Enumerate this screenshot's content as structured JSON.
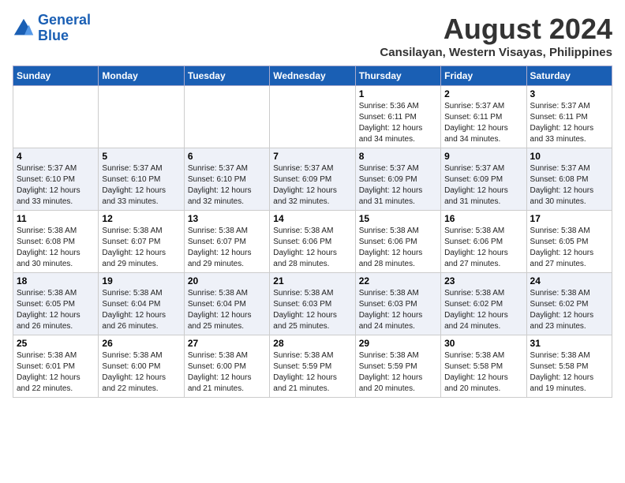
{
  "header": {
    "logo_line1": "General",
    "logo_line2": "Blue",
    "month_year": "August 2024",
    "location": "Cansilayan, Western Visayas, Philippines"
  },
  "days_of_week": [
    "Sunday",
    "Monday",
    "Tuesday",
    "Wednesday",
    "Thursday",
    "Friday",
    "Saturday"
  ],
  "weeks": [
    [
      {
        "day": "",
        "info": ""
      },
      {
        "day": "",
        "info": ""
      },
      {
        "day": "",
        "info": ""
      },
      {
        "day": "",
        "info": ""
      },
      {
        "day": "1",
        "info": "Sunrise: 5:36 AM\nSunset: 6:11 PM\nDaylight: 12 hours\nand 34 minutes."
      },
      {
        "day": "2",
        "info": "Sunrise: 5:37 AM\nSunset: 6:11 PM\nDaylight: 12 hours\nand 34 minutes."
      },
      {
        "day": "3",
        "info": "Sunrise: 5:37 AM\nSunset: 6:11 PM\nDaylight: 12 hours\nand 33 minutes."
      }
    ],
    [
      {
        "day": "4",
        "info": "Sunrise: 5:37 AM\nSunset: 6:10 PM\nDaylight: 12 hours\nand 33 minutes."
      },
      {
        "day": "5",
        "info": "Sunrise: 5:37 AM\nSunset: 6:10 PM\nDaylight: 12 hours\nand 33 minutes."
      },
      {
        "day": "6",
        "info": "Sunrise: 5:37 AM\nSunset: 6:10 PM\nDaylight: 12 hours\nand 32 minutes."
      },
      {
        "day": "7",
        "info": "Sunrise: 5:37 AM\nSunset: 6:09 PM\nDaylight: 12 hours\nand 32 minutes."
      },
      {
        "day": "8",
        "info": "Sunrise: 5:37 AM\nSunset: 6:09 PM\nDaylight: 12 hours\nand 31 minutes."
      },
      {
        "day": "9",
        "info": "Sunrise: 5:37 AM\nSunset: 6:09 PM\nDaylight: 12 hours\nand 31 minutes."
      },
      {
        "day": "10",
        "info": "Sunrise: 5:37 AM\nSunset: 6:08 PM\nDaylight: 12 hours\nand 30 minutes."
      }
    ],
    [
      {
        "day": "11",
        "info": "Sunrise: 5:38 AM\nSunset: 6:08 PM\nDaylight: 12 hours\nand 30 minutes."
      },
      {
        "day": "12",
        "info": "Sunrise: 5:38 AM\nSunset: 6:07 PM\nDaylight: 12 hours\nand 29 minutes."
      },
      {
        "day": "13",
        "info": "Sunrise: 5:38 AM\nSunset: 6:07 PM\nDaylight: 12 hours\nand 29 minutes."
      },
      {
        "day": "14",
        "info": "Sunrise: 5:38 AM\nSunset: 6:06 PM\nDaylight: 12 hours\nand 28 minutes."
      },
      {
        "day": "15",
        "info": "Sunrise: 5:38 AM\nSunset: 6:06 PM\nDaylight: 12 hours\nand 28 minutes."
      },
      {
        "day": "16",
        "info": "Sunrise: 5:38 AM\nSunset: 6:06 PM\nDaylight: 12 hours\nand 27 minutes."
      },
      {
        "day": "17",
        "info": "Sunrise: 5:38 AM\nSunset: 6:05 PM\nDaylight: 12 hours\nand 27 minutes."
      }
    ],
    [
      {
        "day": "18",
        "info": "Sunrise: 5:38 AM\nSunset: 6:05 PM\nDaylight: 12 hours\nand 26 minutes."
      },
      {
        "day": "19",
        "info": "Sunrise: 5:38 AM\nSunset: 6:04 PM\nDaylight: 12 hours\nand 26 minutes."
      },
      {
        "day": "20",
        "info": "Sunrise: 5:38 AM\nSunset: 6:04 PM\nDaylight: 12 hours\nand 25 minutes."
      },
      {
        "day": "21",
        "info": "Sunrise: 5:38 AM\nSunset: 6:03 PM\nDaylight: 12 hours\nand 25 minutes."
      },
      {
        "day": "22",
        "info": "Sunrise: 5:38 AM\nSunset: 6:03 PM\nDaylight: 12 hours\nand 24 minutes."
      },
      {
        "day": "23",
        "info": "Sunrise: 5:38 AM\nSunset: 6:02 PM\nDaylight: 12 hours\nand 24 minutes."
      },
      {
        "day": "24",
        "info": "Sunrise: 5:38 AM\nSunset: 6:02 PM\nDaylight: 12 hours\nand 23 minutes."
      }
    ],
    [
      {
        "day": "25",
        "info": "Sunrise: 5:38 AM\nSunset: 6:01 PM\nDaylight: 12 hours\nand 22 minutes."
      },
      {
        "day": "26",
        "info": "Sunrise: 5:38 AM\nSunset: 6:00 PM\nDaylight: 12 hours\nand 22 minutes."
      },
      {
        "day": "27",
        "info": "Sunrise: 5:38 AM\nSunset: 6:00 PM\nDaylight: 12 hours\nand 21 minutes."
      },
      {
        "day": "28",
        "info": "Sunrise: 5:38 AM\nSunset: 5:59 PM\nDaylight: 12 hours\nand 21 minutes."
      },
      {
        "day": "29",
        "info": "Sunrise: 5:38 AM\nSunset: 5:59 PM\nDaylight: 12 hours\nand 20 minutes."
      },
      {
        "day": "30",
        "info": "Sunrise: 5:38 AM\nSunset: 5:58 PM\nDaylight: 12 hours\nand 20 minutes."
      },
      {
        "day": "31",
        "info": "Sunrise: 5:38 AM\nSunset: 5:58 PM\nDaylight: 12 hours\nand 19 minutes."
      }
    ]
  ]
}
